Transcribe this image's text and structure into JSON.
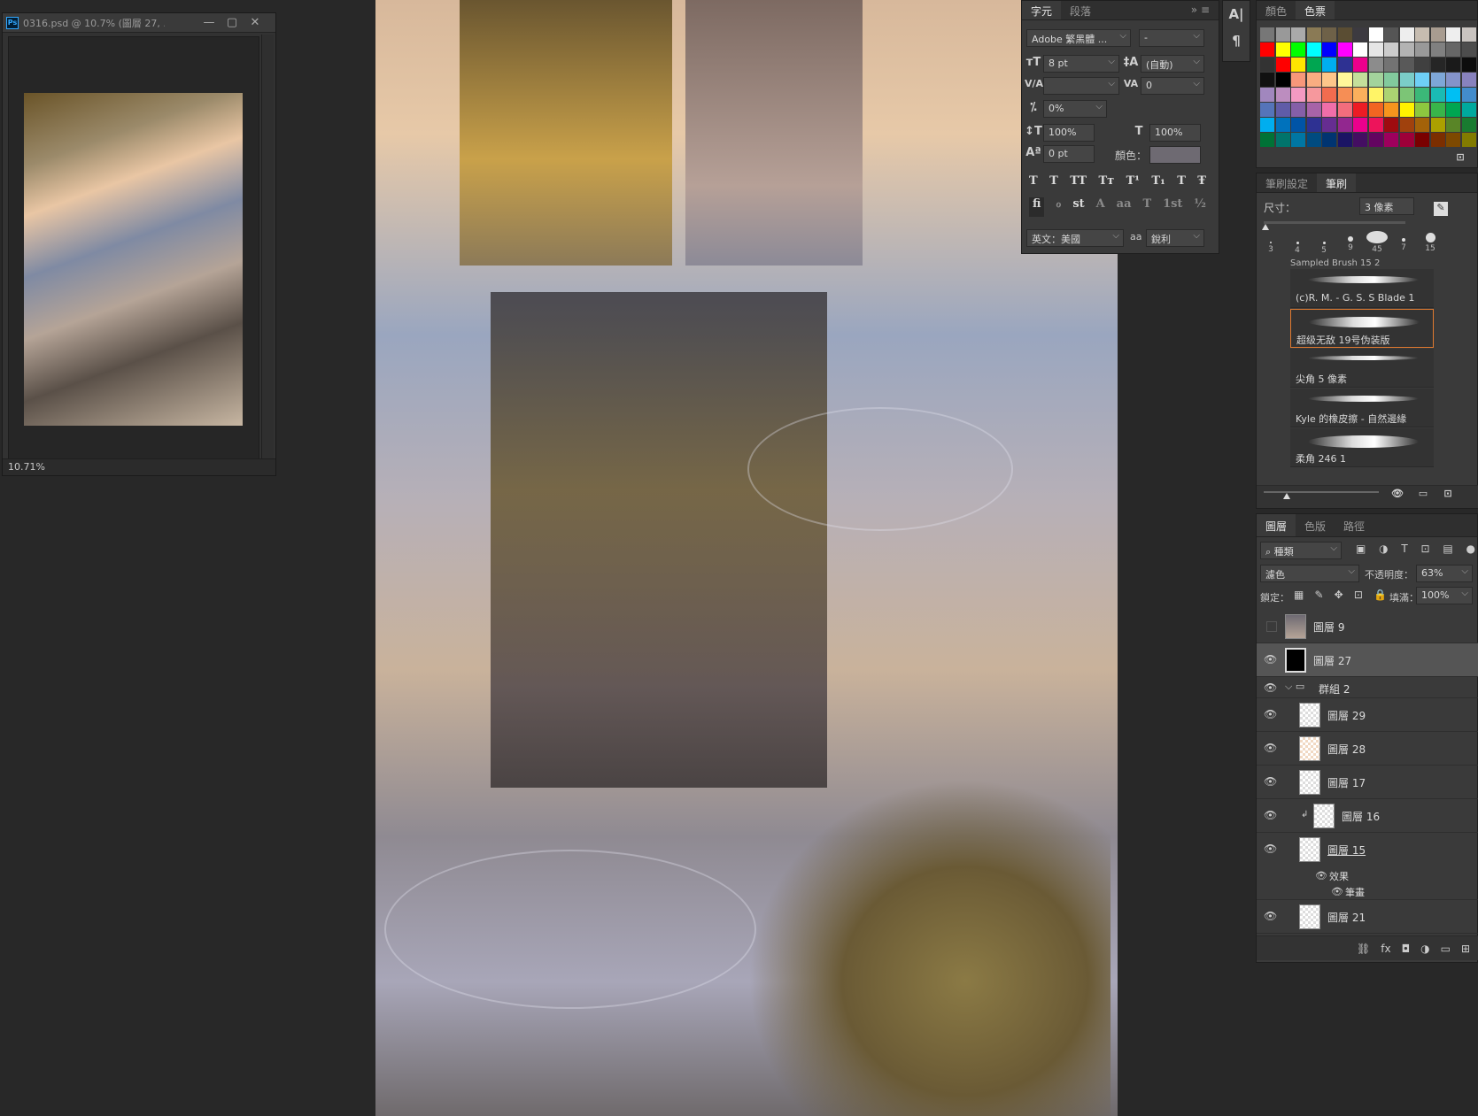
{
  "navigator": {
    "title": "0316.psd @ 10.7% (圖層 27, ...",
    "zoom": "10.71%",
    "controls": {
      "minimize": "—",
      "restore": "▢",
      "close": "✕"
    }
  },
  "character_panel": {
    "tabs": [
      "字元",
      "段落"
    ],
    "menu_icons": "»  ≡",
    "font_family": "Adobe 繁黑體 ...",
    "font_style": "-",
    "font_size": "8 pt",
    "leading": "(自動)",
    "kerning": "",
    "tracking": "0",
    "tsume": "0%",
    "vertical_scale": "100%",
    "horizontal_scale": "100%",
    "baseline_shift": "0 pt",
    "color_label": "顏色：",
    "color_value": "#6e6a72",
    "type_buttons": [
      "T",
      "T",
      "TT",
      "Tт",
      "T¹",
      "T₁",
      "T",
      "Ŧ"
    ],
    "opentype_buttons": [
      "fi",
      "ℴ",
      "st",
      "A",
      "aa",
      "T",
      "1st",
      "½"
    ],
    "language": "英文：美國",
    "antialias_label": "aa",
    "antialias": "銳利"
  },
  "mini_toolbar": {
    "icons": [
      "A|",
      "¶"
    ]
  },
  "swatches_panel": {
    "tabs": [
      "顏色",
      "色票"
    ]
  },
  "brush_panel": {
    "tabs": [
      "筆刷設定",
      "筆刷"
    ],
    "size_label": "尺寸：",
    "size_value": "3 像素",
    "tip_sizes": [
      "3",
      "4",
      "5",
      "9",
      "45",
      "7",
      "15"
    ],
    "clipped_top": "Sampled Brush 15 2",
    "brushes": [
      {
        "name": "(c)R. M. - G. S. S Blade 1"
      },
      {
        "name": "超级无敌 19号伪装版"
      },
      {
        "name": "尖角 5 像素"
      },
      {
        "name": "Kyle 的橡皮擦 - 自然邊緣"
      },
      {
        "name": "柔角 246 1"
      }
    ]
  },
  "layers_panel": {
    "tabs": [
      "圖層",
      "色版",
      "路徑"
    ],
    "filter": "種類",
    "blend_mode": "濾色",
    "opacity_label": "不透明度：",
    "opacity": "63%",
    "lock_label": "鎖定：",
    "fill_label": "填滿：",
    "fill": "100%",
    "layers": [
      {
        "name": "圖層 9",
        "visible": false
      },
      {
        "name": "圖層 27",
        "visible": true,
        "selected": true
      },
      {
        "name": "群組 2",
        "visible": true,
        "group": true
      },
      {
        "name": "圖層 29",
        "visible": true
      },
      {
        "name": "圖層 28",
        "visible": true
      },
      {
        "name": "圖層 17",
        "visible": true
      },
      {
        "name": "圖層 16",
        "visible": true,
        "clipped": true
      },
      {
        "name": "圖層 15",
        "visible": true
      },
      {
        "name": "效果",
        "visible": true,
        "effect": true
      },
      {
        "name": "筆畫",
        "visible": true,
        "effect": true
      },
      {
        "name": "圖層 21",
        "visible": true
      }
    ],
    "footer_icons": [
      "⛓",
      "fx",
      "◘",
      "◑",
      "▭",
      "⊞"
    ]
  }
}
